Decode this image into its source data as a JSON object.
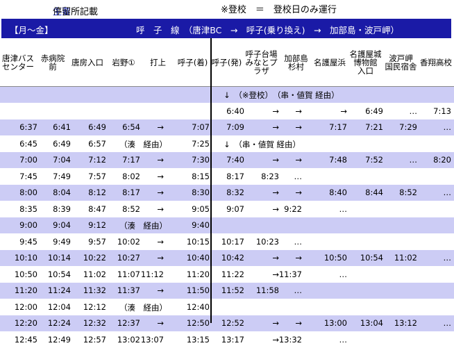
{
  "top": {
    "title_accent": "主要",
    "title_rest": "停留所記載",
    "note": "※登校　＝　登校日のみ運行"
  },
  "header": {
    "days": "【月～金】",
    "route": "呼　子　線　（唐津BC　→　呼子(乗り換え)　→　加部島・波戸岬）"
  },
  "columns": [
    "唐津バス\nセンター",
    "赤病院\n前",
    "唐房入口",
    "岩野①",
    "打上",
    "呼子(着)",
    "呼子(発)",
    "呼子台場\nみなとプ\nラザ",
    "加部島\n杉村",
    "名護屋浜",
    "名護屋城\n博物館\n入口",
    "波戸岬\n国民宿舎",
    "香翔高校"
  ],
  "rows": [
    {
      "shade": true,
      "cells": [
        "",
        "",
        "",
        "",
        "",
        "",
        "",
        "",
        "",
        "",
        "",
        "",
        ""
      ],
      "left_note": "",
      "right_note": "↓　（※登校）　（串・値賀 経由）"
    },
    {
      "shade": false,
      "cells": [
        "",
        "",
        "",
        "",
        "",
        "",
        "6:40",
        "→",
        "→",
        "→",
        "6:49",
        "…",
        "7:13"
      ],
      "left_note": "",
      "right_note": ""
    },
    {
      "shade": true,
      "cells": [
        "6:37",
        "6:41",
        "6:49",
        "6:54",
        "→",
        "7:07",
        "7:09",
        "→",
        "→",
        "7:17",
        "7:21",
        "7:29",
        "…"
      ],
      "left_note": "",
      "right_note": ""
    },
    {
      "shade": false,
      "cells": [
        "6:45",
        "6:49",
        "6:57",
        "",
        "",
        "7:25",
        "",
        "",
        "",
        "",
        "",
        "",
        ""
      ],
      "left_note": "（湊　経由）",
      "right_note": "↓　（串・値賀 経由）"
    },
    {
      "shade": true,
      "cells": [
        "7:00",
        "7:04",
        "7:12",
        "7:17",
        "→",
        "7:30",
        "7:40",
        "→",
        "→",
        "7:48",
        "7:52",
        "…",
        "8:20"
      ],
      "left_note": "",
      "right_note": ""
    },
    {
      "shade": false,
      "cells": [
        "7:45",
        "7:49",
        "7:57",
        "8:02",
        "→",
        "8:15",
        "8:17",
        "8:23",
        "…",
        "",
        "",
        "",
        ""
      ],
      "left_note": "",
      "right_note": ""
    },
    {
      "shade": true,
      "cells": [
        "8:00",
        "8:04",
        "8:12",
        "8:17",
        "→",
        "8:30",
        "8:32",
        "→",
        "→",
        "8:40",
        "8:44",
        "8:52",
        "…"
      ],
      "left_note": "",
      "right_note": ""
    },
    {
      "shade": false,
      "cells": [
        "8:35",
        "8:39",
        "8:47",
        "8:52",
        "→",
        "9:05",
        "9:07",
        "→",
        "9:22",
        "…",
        "",
        "",
        ""
      ],
      "left_note": "",
      "right_note": ""
    },
    {
      "shade": true,
      "cells": [
        "9:00",
        "9:04",
        "9:12",
        "",
        "",
        "9:40",
        "",
        "",
        "",
        "",
        "",
        "",
        ""
      ],
      "left_note": "（湊　経由）",
      "right_note": ""
    },
    {
      "shade": false,
      "cells": [
        "9:45",
        "9:49",
        "9:57",
        "10:02",
        "→",
        "10:15",
        "10:17",
        "10:23",
        "…",
        "",
        "",
        "",
        ""
      ],
      "left_note": "",
      "right_note": ""
    },
    {
      "shade": true,
      "cells": [
        "10:10",
        "10:14",
        "10:22",
        "10:27",
        "→",
        "10:40",
        "10:42",
        "→",
        "→",
        "10:50",
        "10:54",
        "11:02",
        "…"
      ],
      "left_note": "",
      "right_note": ""
    },
    {
      "shade": false,
      "cells": [
        "10:50",
        "10:54",
        "11:02",
        "11:07",
        "11:12",
        "11:20",
        "11:22",
        "→",
        "11:37",
        "…",
        "",
        "",
        ""
      ],
      "left_note": "",
      "right_note": ""
    },
    {
      "shade": true,
      "cells": [
        "11:20",
        "11:24",
        "11:32",
        "11:37",
        "→",
        "11:50",
        "11:52",
        "11:58",
        "…",
        "",
        "",
        "",
        ""
      ],
      "left_note": "",
      "right_note": ""
    },
    {
      "shade": false,
      "cells": [
        "12:00",
        "12:04",
        "12:12",
        "",
        "",
        "12:40",
        "",
        "",
        "",
        "",
        "",
        "",
        ""
      ],
      "left_note": "（湊　経由）",
      "right_note": ""
    },
    {
      "shade": true,
      "cells": [
        "12:20",
        "12:24",
        "12:32",
        "12:37",
        "→",
        "12:50",
        "12:52",
        "→",
        "→",
        "13:00",
        "13:04",
        "13:12",
        "…"
      ],
      "left_note": "",
      "right_note": ""
    },
    {
      "shade": false,
      "cells": [
        "12:45",
        "12:49",
        "12:57",
        "13:02",
        "13:07",
        "13:15",
        "13:17",
        "→",
        "13:32",
        "…",
        "",
        "",
        ""
      ],
      "left_note": "",
      "right_note": ""
    }
  ]
}
